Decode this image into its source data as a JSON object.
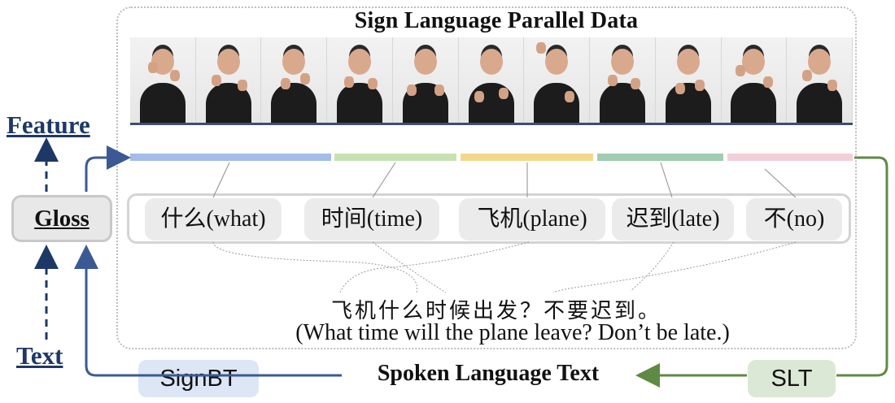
{
  "title": "Sign Language Parallel Data",
  "frame_count": 11,
  "segments": [
    {
      "color": "#a3bce8"
    },
    {
      "color": "#c6e2b3"
    },
    {
      "color": "#f3d88c"
    },
    {
      "color": "#9fccb2"
    },
    {
      "color": "#f2cfd8"
    }
  ],
  "glosses": [
    {
      "zh": "什么",
      "en": "(what)"
    },
    {
      "zh": "时间",
      "en": "(time)"
    },
    {
      "zh": "飞机",
      "en": "(plane)"
    },
    {
      "zh": "迟到",
      "en": "(late)"
    },
    {
      "zh": "不",
      "en": "(no)"
    }
  ],
  "sentence": {
    "zh": "飞机什么时候出发？不要迟到。",
    "en": "(What time will the plane leave?  Don’t be late.)"
  },
  "labels": {
    "feature": "Feature",
    "gloss": "Gloss",
    "text": "Text",
    "signbt": "SignBT",
    "slt": "SLT",
    "spoken": "Spoken Language Text"
  },
  "colors": {
    "blue_arrow": "#3b5a94",
    "green_arrow": "#5f8a45"
  }
}
